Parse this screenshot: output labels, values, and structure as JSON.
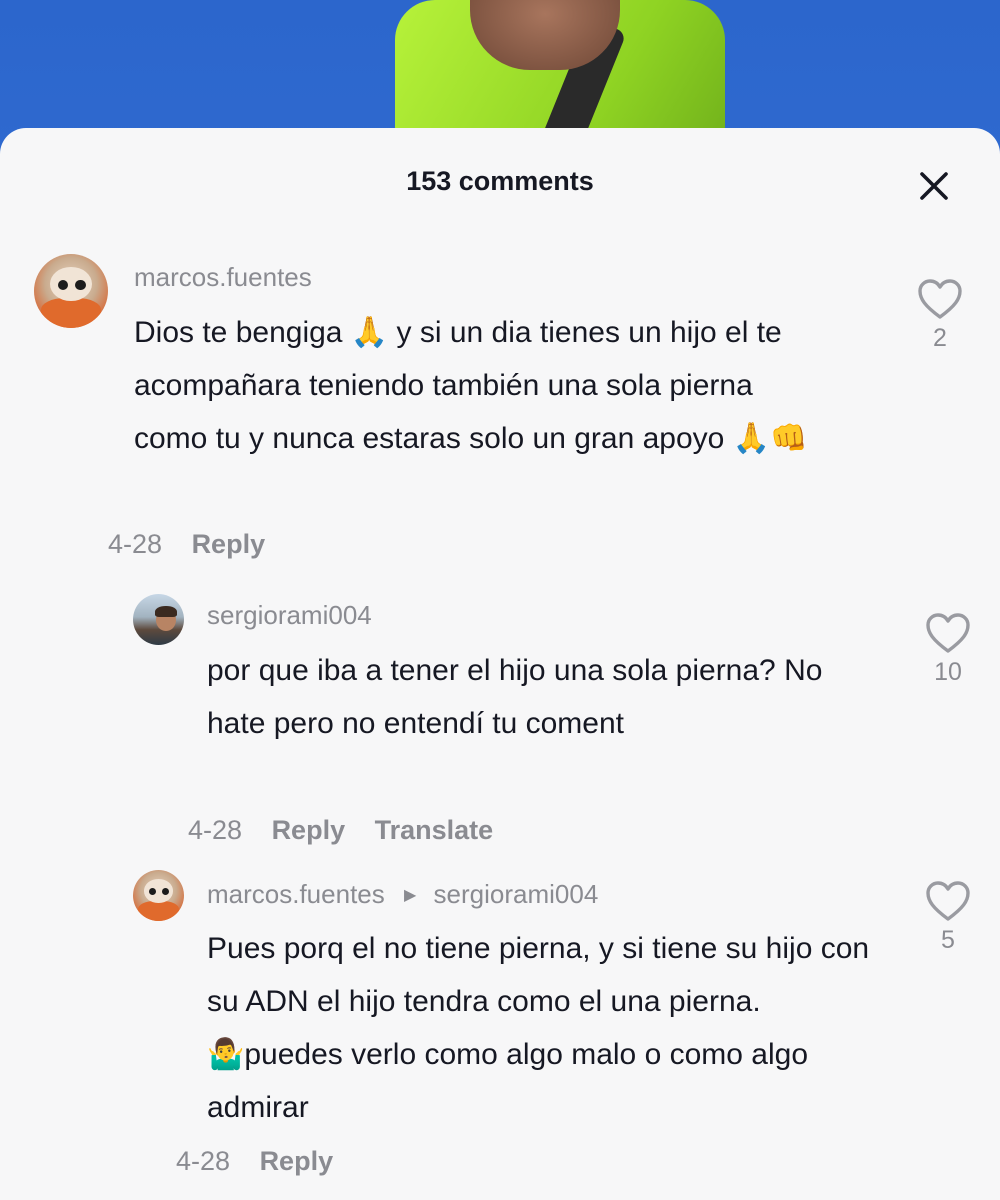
{
  "sheet": {
    "title": "153 comments"
  },
  "comments": [
    {
      "username": "marcos.fuentes",
      "text": "Dios te bengiga 🙏 y si un dia tienes un hijo el te acompañara teniendo también una sola pierna como tu y nunca estaras solo un gran apoyo 🙏👊",
      "date": "4-28",
      "reply_label": "Reply",
      "likes": "2",
      "avatar_icon": "cat-avatar"
    },
    {
      "username": "sergiorami004",
      "text": "por que iba a tener el hijo una sola pierna? No hate pero no entendí tu coment",
      "date": "4-28",
      "reply_label": "Reply",
      "translate_label": "Translate",
      "likes": "10",
      "avatar_icon": "person-avatar"
    },
    {
      "username": "marcos.fuentes",
      "reply_to": "sergiorami004",
      "text": "Pues porq el no tiene pierna, y si tiene su hijo con su ADN el hijo tendra como el una pierna. 🤷‍♂️puedes verlo como algo malo o como algo admirar",
      "date": "4-28",
      "reply_label": "Reply",
      "likes": "5",
      "avatar_icon": "cat-avatar"
    }
  ],
  "colors": {
    "sheet_bg": "#f7f7f8",
    "text_primary": "#161823",
    "text_secondary": "#8a8b91",
    "video_bg": "#2c66cc",
    "vest": "#9be02a"
  },
  "icons": {
    "close": "close-icon",
    "like": "heart-outline-icon",
    "reply_arrow": "triangle-right-icon"
  }
}
